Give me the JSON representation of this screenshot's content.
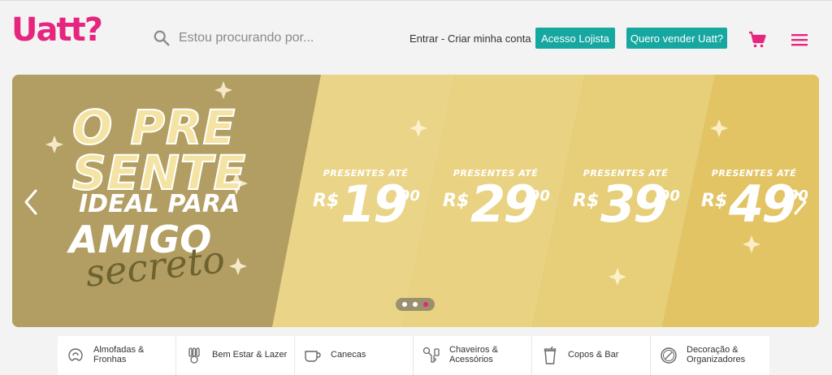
{
  "header": {
    "logo": "Uatt?",
    "search_placeholder": "Estou procurando por...",
    "login_link": "Entrar - Criar minha conta",
    "btn_lojista": "Acesso Lojista",
    "btn_vender": "Quero vender Uatt?"
  },
  "banner": {
    "headline_1": "O PRE",
    "headline_2": "SENTE",
    "headline_3": "IDEAL PARA",
    "headline_4": "AMIGO",
    "headline_5": "secreto",
    "prices": [
      {
        "pre": "PRESENTES ATÉ",
        "cur": "R$",
        "num": "19",
        "cents": ",90"
      },
      {
        "pre": "PRESENTES ATÉ",
        "cur": "R$",
        "num": "29",
        "cents": ",90"
      },
      {
        "pre": "PRESENTES ATÉ",
        "cur": "R$",
        "num": "39",
        "cents": ",90"
      },
      {
        "pre": "PRESENTES ATÉ",
        "cur": "R$",
        "num": "49",
        "cents": ",90"
      }
    ],
    "active_slide": 3,
    "slide_count": 3
  },
  "categories": [
    {
      "label": "Almofadas & Fronhas",
      "icon": "pillow-icon"
    },
    {
      "label": "Bem Estar & Lazer",
      "icon": "wellness-icon"
    },
    {
      "label": "Canecas",
      "icon": "mug-icon"
    },
    {
      "label": "Chaveiros & Acessórios",
      "icon": "keychain-icon"
    },
    {
      "label": "Copos & Bar",
      "icon": "cup-icon"
    },
    {
      "label": "Decoração & Organizadores",
      "icon": "decor-icon"
    }
  ],
  "colors": {
    "brand": "#e6267e",
    "teal": "#17a7a1",
    "gold": "#e6c866"
  }
}
